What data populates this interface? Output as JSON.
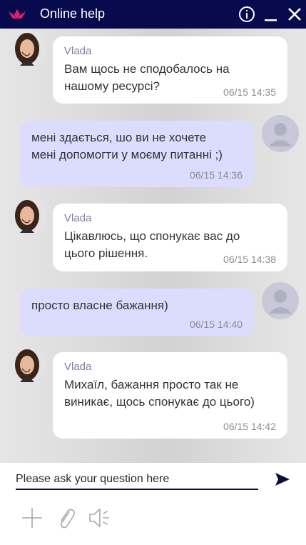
{
  "window": {
    "title": "Online help"
  },
  "messages": [
    {
      "from": "agent",
      "sender": "Vlada",
      "lines": [
        "Вам щось не сподобалось на",
        "нашому ресурсі?"
      ],
      "time": "06/15 14:35"
    },
    {
      "from": "user",
      "lines": [
        "мені здається, шо ви не хочете",
        "мені допомогти у моєму питанні ;)"
      ],
      "time": "06/15 14:36"
    },
    {
      "from": "agent",
      "sender": "Vlada",
      "lines": [
        "Цікавлюсь, що спонукає вас до",
        "цього рішення."
      ],
      "time": "06/15 14:38"
    },
    {
      "from": "user",
      "lines": [
        "просто власне бажання)"
      ],
      "time": "06/15 14:40"
    },
    {
      "from": "agent",
      "sender": "Vlada",
      "lines": [
        "Михаїл, бажання просто так не",
        "виникає, щось спонукає до цього)"
      ],
      "time": "06/15 14:42"
    }
  ],
  "composer": {
    "placeholder": "Please ask your question here",
    "value": ""
  },
  "icons": {
    "logo": "lotus-logo-icon",
    "info": "info-icon",
    "minimize": "minimize-icon",
    "close": "close-icon",
    "send": "send-icon",
    "add": "plus-icon",
    "attach": "paperclip-icon",
    "sound": "speaker-muted-icon"
  },
  "colors": {
    "titlebar": "#070b4d",
    "agent_bubble": "#ffffff",
    "user_bubble": "#dcdcff",
    "accent": "#d81b60"
  }
}
